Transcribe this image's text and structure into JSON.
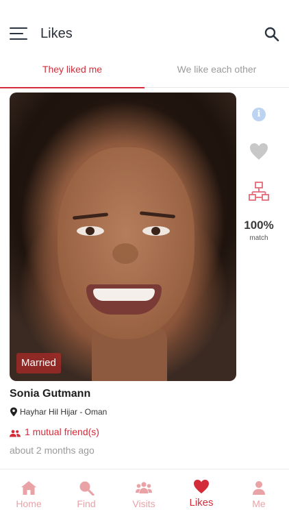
{
  "header": {
    "title": "Likes",
    "menu_icon": "hamburger-menu-icon",
    "search_icon": "search-icon"
  },
  "tabs": [
    {
      "label": "They liked me",
      "active": true
    },
    {
      "label": "We like each other",
      "active": false
    }
  ],
  "profile": {
    "status_badge": "Married",
    "name": "Sonia Gutmann",
    "location": "Hayhar Hil Hijar - Oman",
    "mutual_friends": "1 mutual friend(s)",
    "time_ago": "about 2 months ago"
  },
  "side_actions": {
    "info_glyph": "i",
    "match_percent": "100%",
    "match_label": "match"
  },
  "bottom_nav": [
    {
      "label": "Home",
      "icon": "home-icon",
      "active": false
    },
    {
      "label": "Find",
      "icon": "search-icon",
      "active": false
    },
    {
      "label": "Visits",
      "icon": "group-icon",
      "active": false
    },
    {
      "label": "Likes",
      "icon": "heart-icon",
      "active": true
    },
    {
      "label": "Me",
      "icon": "person-icon",
      "active": false
    }
  ],
  "colors": {
    "accent": "#d32b3a",
    "accent_light": "#e9a2a6",
    "muted_text": "#9a9a9a",
    "info_blue": "#bcd4f2",
    "heart_gray": "#c8c8c8"
  }
}
